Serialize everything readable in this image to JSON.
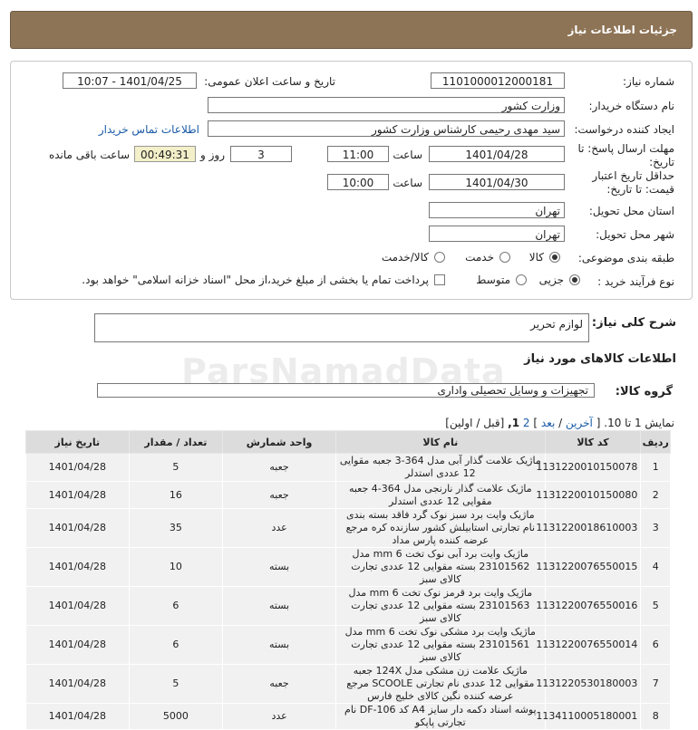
{
  "header": {
    "title": "جزئیات اطلاعات نیاز"
  },
  "form": {
    "need_number_label": "شماره نیاز:",
    "need_number": "1101000012000181",
    "announce_label": "تاریخ و ساعت اعلان عمومی:",
    "announce_value": "1401/04/25 - 10:07",
    "buyer_label": "نام دستگاه خریدار:",
    "buyer_value": "وزارت کشور",
    "creator_label": "ایجاد کننده درخواست:",
    "creator_value": "سید مهدی رحیمی کارشناس وزارت کشور",
    "contact_link": "اطلاعات تماس خریدار",
    "deadline_label_1": "مهلت ارسال پاسخ: تا",
    "deadline_label_2": "تاریخ:",
    "deadline_date": "1401/04/28",
    "time_label": "ساعت",
    "deadline_time": "11:00",
    "days_value": "3",
    "days_label": "روز و",
    "remaining_time": "00:49:31",
    "remaining_label": "ساعت باقی مانده",
    "validity_label_1": "حداقل تاریخ اعتبار",
    "validity_label_2": "قیمت: تا تاریخ:",
    "validity_date": "1401/04/30",
    "validity_time_label": "ساعت",
    "validity_time": "10:00",
    "province_label": "استان محل تحویل:",
    "province_value": "تهران",
    "city_label": "شهر محل تحویل:",
    "city_value": "تهران",
    "category_label": "طبقه بندی موضوعی:",
    "category_options": [
      "کالا",
      "خدمت",
      "کالا/خدمت"
    ],
    "category_selected": "کالا",
    "process_label": "نوع فرآیند خرید :",
    "process_options": [
      "جزیی",
      "متوسط"
    ],
    "process_selected": "جزیی",
    "payment_note": "پرداخت تمام یا بخشی از مبلغ خرید،از محل \"اسناد خزانه اسلامی\" خواهد بود."
  },
  "description": {
    "label": "شرح کلی نیاز:",
    "value": "لوازم تحریر"
  },
  "goods": {
    "section_title": "اطلاعات کالاهای مورد نیاز",
    "group_label": "گروه کالا:",
    "group_value": "تجهیزات و وسایل تحصیلی واداری"
  },
  "pager": {
    "showing": "نمایش 1 تا 10.",
    "last": "آخرین",
    "next": "بعد",
    "page2": "2",
    "page1": "1,",
    "rest": "[قبل / اولین]"
  },
  "table": {
    "headers": [
      "ردیف",
      "کد کالا",
      "نام کالا",
      "واحد شمارش",
      "تعداد / مقدار",
      "تاریخ نیاز"
    ],
    "rows": [
      {
        "n": "1",
        "code": "1131220010150078",
        "name": "ماژیک علامت گذار آبی مدل 364-3 جعبه مقوایی 12 عددی استدلر",
        "unit": "جعبه",
        "qty": "5",
        "date": "1401/04/28"
      },
      {
        "n": "2",
        "code": "1131220010150080",
        "name": "ماژیک علامت گذار نارنجی مدل 364-4 جعبه مقوایی 12 عددی استدلر",
        "unit": "جعبه",
        "qty": "16",
        "date": "1401/04/28"
      },
      {
        "n": "3",
        "code": "1131220018610003",
        "name": "ماژیک وایت برد سبز نوک گرد فاقد بسته بندی نام تجارتی استابیلش کشور سازنده کره مرجع عرضه کننده پارس مداد",
        "unit": "عدد",
        "qty": "35",
        "date": "1401/04/28"
      },
      {
        "n": "4",
        "code": "1131220076550015",
        "name": "ماژیک وایت برد آبی نوک تخت 6 mm مدل 23101562 بسته مقوایی 12 عددی تجارت کالای سبز",
        "unit": "بسته",
        "qty": "10",
        "date": "1401/04/28"
      },
      {
        "n": "5",
        "code": "1131220076550016",
        "name": "ماژیک وایت برد قرمز نوک تخت 6 mm مدل 23101563 بسته مقوایی 12 عددی تجارت کالای سبز",
        "unit": "بسته",
        "qty": "6",
        "date": "1401/04/28"
      },
      {
        "n": "6",
        "code": "1131220076550014",
        "name": "ماژیک وایت برد مشکی نوک تخت 6 mm مدل 23101561 بسته مقوایی 12 عددی تجارت کالای سبز",
        "unit": "بسته",
        "qty": "6",
        "date": "1401/04/28"
      },
      {
        "n": "7",
        "code": "1131220530180003",
        "name": "ماژیک علامت زن مشکی مدل 124X جعبه مقوایی 12 عددی نام تجارتی SCOOLE مرجع عرضه کننده نگین کالای خلیج فارس",
        "unit": "جعبه",
        "qty": "5",
        "date": "1401/04/28"
      },
      {
        "n": "8",
        "code": "1134110005180001",
        "name": "پوشه اسناد دکمه دار سایز A4 کد DF-106 نام تجارتی پاپکو",
        "unit": "عدد",
        "qty": "5000",
        "date": "1401/04/28"
      }
    ]
  },
  "watermark": "ParsNamadData"
}
